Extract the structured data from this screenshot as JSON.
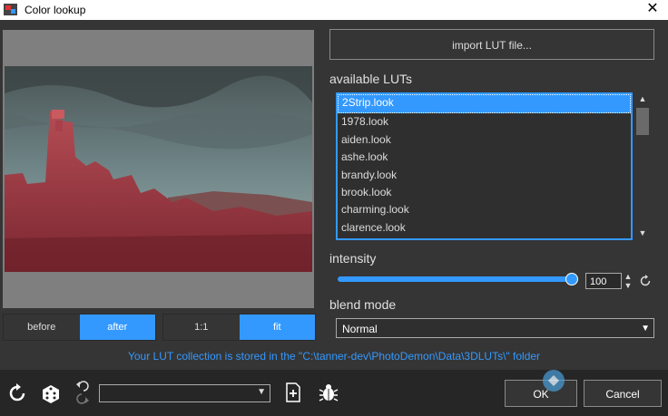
{
  "window": {
    "title": "Color lookup",
    "close_glyph": "✕"
  },
  "preview": {
    "before_label": "before",
    "after_label": "after",
    "zoom_1to1_label": "1:1",
    "fit_label": "fit",
    "active_compare": "after",
    "active_zoom": "fit"
  },
  "lut_panel": {
    "import_label": "import LUT file...",
    "available_label": "available LUTs",
    "items": [
      "2Strip.look",
      "1978.look",
      "aiden.look",
      "ashe.look",
      "brandy.look",
      "brook.look",
      "charming.look",
      "clarence.look"
    ],
    "selected_index": 0
  },
  "intensity": {
    "label": "intensity",
    "value": "100",
    "level": 100
  },
  "blend": {
    "label": "blend mode",
    "value": "Normal"
  },
  "info_text": "Your LUT collection is stored in the \"C:\\tanner-dev\\PhotoDemon\\Data\\3DLUTs\\\" folder",
  "footer": {
    "ok_label": "OK",
    "cancel_label": "Cancel",
    "preset_value": ""
  },
  "colors": {
    "accent": "#3399ff",
    "background": "#353535",
    "footer": "#262626"
  }
}
